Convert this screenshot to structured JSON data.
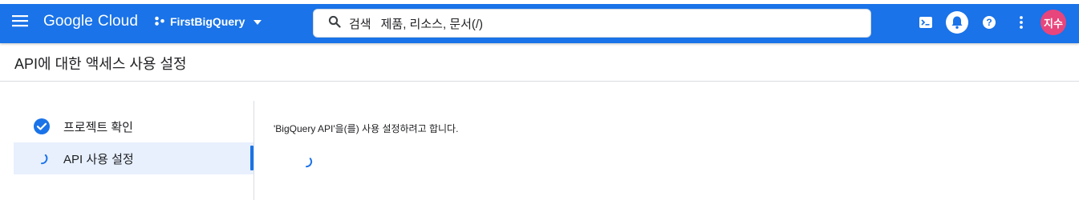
{
  "topbar": {
    "brand_google": "Google",
    "brand_cloud": "Cloud",
    "project_name": "FirstBigQuery",
    "search_label": "검색",
    "search_placeholder": "제품, 리소스, 문서(/)",
    "avatar_initials": "지수",
    "icons": [
      "menu-icon",
      "project-icon",
      "chevron-down-icon",
      "search-icon",
      "terminal-icon",
      "bell-icon",
      "help-icon",
      "more-vert-icon"
    ]
  },
  "page": {
    "title": "API에 대한 액세스 사용 설정"
  },
  "stepper": {
    "steps": [
      {
        "label": "프로젝트 확인",
        "state": "done"
      },
      {
        "label": "API 사용 설정",
        "state": "in-progress"
      }
    ]
  },
  "content": {
    "message": "'BigQuery API'을(를) 사용 설정하려고 합니다."
  },
  "colors": {
    "accent": "#1a73e8",
    "avatar": "#e8457c",
    "active_step_bg": "#e8f0fe"
  }
}
